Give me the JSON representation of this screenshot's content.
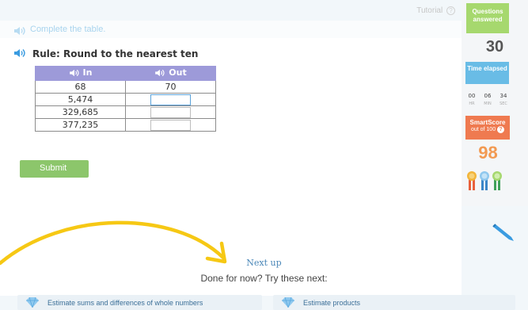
{
  "header": {
    "tutorial_label": "Tutorial",
    "help_icon_glyph": "?",
    "instruction": "Complete the table."
  },
  "question": {
    "rule": "Rule: Round to the nearest ten",
    "columns": [
      "In",
      "Out"
    ],
    "rows": [
      {
        "in": "68",
        "out": "70"
      },
      {
        "in": "5,474",
        "out": ""
      },
      {
        "in": "329,685",
        "out": ""
      },
      {
        "in": "377,235",
        "out": ""
      }
    ],
    "submit_label": "Submit"
  },
  "sidebar": {
    "questions_answered_label": "Questions answered",
    "questions_count": "30",
    "time_elapsed_label": "Time elapsed",
    "timer": {
      "hr": "00",
      "min": "06",
      "sec": "34",
      "hr_label": "HR",
      "min_label": "MIN",
      "sec_label": "SEC"
    },
    "smartscore_label": "SmartScore",
    "smartscore_sub": "out of 100",
    "smartscore_help": "?",
    "score": "98"
  },
  "next_up": {
    "title": "Next up",
    "subtitle": "Done for now? Try these next:",
    "cards": [
      {
        "label": "Estimate sums and differences of whole numbers",
        "icon": "diamond-icon"
      },
      {
        "label": "Estimate products",
        "icon": "diamond-icon"
      }
    ]
  },
  "colors": {
    "header_purple": "#9d9ad9",
    "submit_green": "#8cc66b",
    "answered_green": "#a6d86e",
    "time_blue": "#69bce6",
    "smartscore_orange": "#ef7a50",
    "score_orange": "#f29a52",
    "arrow_yellow": "#f6c814"
  }
}
